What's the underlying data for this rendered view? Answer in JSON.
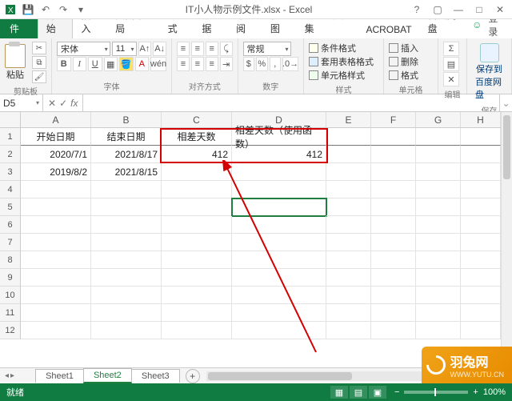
{
  "titlebar": {
    "document_title": "IT小人物示例文件.xlsx - Excel"
  },
  "menu": {
    "file": "文件",
    "tabs": [
      "开始",
      "插入",
      "页面布局",
      "公式",
      "数据",
      "审阅",
      "视图",
      "PDF工具集",
      "ACROBAT",
      "百度网盘"
    ],
    "active_index": 0,
    "signin": "登录"
  },
  "ribbon": {
    "clipboard": {
      "paste": "粘贴",
      "label": "剪贴板"
    },
    "font": {
      "name": "宋体",
      "size": "11",
      "label": "字体",
      "bold": "B",
      "italic": "I",
      "underline": "U"
    },
    "align": {
      "label": "对齐方式",
      "wrap": "自动换行",
      "merge": "合并后居中"
    },
    "number": {
      "format": "常规",
      "label": "数字"
    },
    "styles": {
      "cond": "条件格式",
      "tablefmt": "套用表格格式",
      "cellstyle": "单元格样式",
      "label": "样式"
    },
    "cells": {
      "insert": "插入",
      "delete": "删除",
      "format": "格式",
      "label": "单元格"
    },
    "editing": {
      "label": "编辑"
    },
    "save": {
      "line1": "保存到",
      "line2": "百度网盘",
      "label": "保存"
    }
  },
  "namebox": {
    "ref": "D5"
  },
  "columns": [
    "A",
    "B",
    "C",
    "D",
    "E",
    "F",
    "G",
    "H"
  ],
  "row_numbers": [
    "1",
    "2",
    "3",
    "4",
    "5",
    "6",
    "7",
    "8",
    "9",
    "10",
    "11",
    "12"
  ],
  "headers": {
    "A": "开始日期",
    "B": "结束日期",
    "C": "相差天数",
    "D": "相差天数（使用函数）"
  },
  "data_rows": [
    {
      "A": "2020/7/1",
      "B": "2021/8/17",
      "C": "412",
      "D": "412"
    },
    {
      "A": "2019/8/2",
      "B": "2021/8/15",
      "C": "",
      "D": ""
    }
  ],
  "sheets": {
    "names": [
      "Sheet1",
      "Sheet2",
      "Sheet3"
    ],
    "active": 1,
    "add": "+"
  },
  "status": {
    "ready": "就绪",
    "zoom": "100%"
  },
  "watermark": {
    "brand": "羽兔网",
    "url": "WWW.YUTU.CN"
  }
}
